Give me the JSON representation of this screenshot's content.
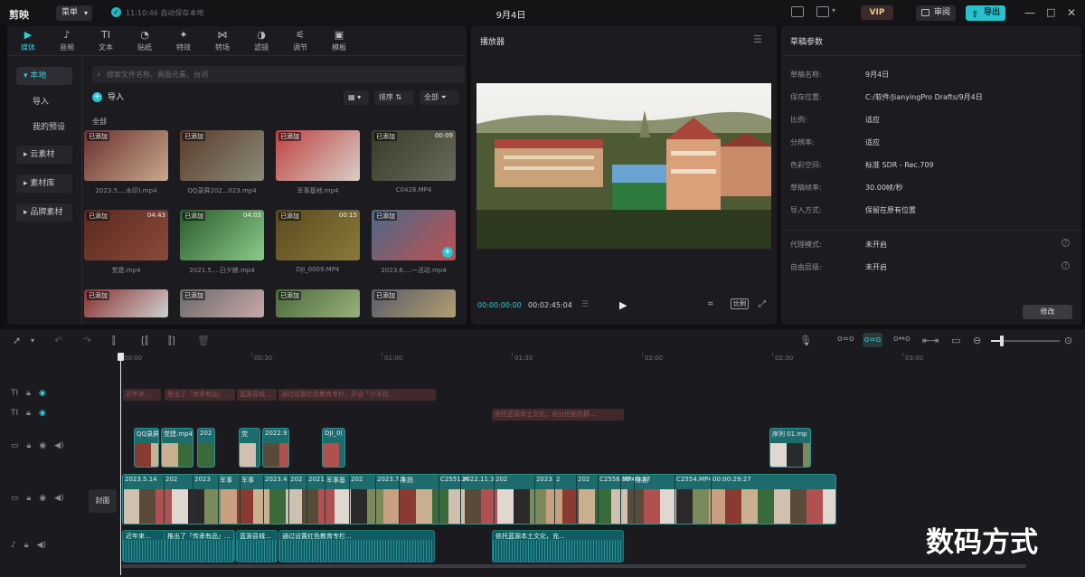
{
  "app": {
    "name": "剪映",
    "menu_label": "菜单",
    "autosave": "11:10:46 自动保存本地",
    "project_title": "9月4日",
    "vip_label": "VIP",
    "review_label": "审阅",
    "export_label": "导出"
  },
  "media_toolbar": [
    {
      "label": "媒体",
      "icon": "media-icon",
      "active": true
    },
    {
      "label": "音频",
      "icon": "audio-icon"
    },
    {
      "label": "文本",
      "icon": "text-icon"
    },
    {
      "label": "贴纸",
      "icon": "sticker-icon"
    },
    {
      "label": "特效",
      "icon": "effects-icon"
    },
    {
      "label": "转场",
      "icon": "transition-icon"
    },
    {
      "label": "滤镜",
      "icon": "filter-icon"
    },
    {
      "label": "调节",
      "icon": "adjust-icon"
    },
    {
      "label": "模板",
      "icon": "template-icon"
    }
  ],
  "media_sidebar": {
    "local": "本地",
    "import": "导入",
    "presets": "我的预设",
    "cloud": "云素材",
    "library": "素材库",
    "brand": "品牌素材"
  },
  "media": {
    "search_placeholder": "搜索文件名称、画面元素、台词",
    "import_label": "导入",
    "sort_label": "排序",
    "all_filter": "全部",
    "all_label": "全部",
    "items": [
      {
        "name": "2023.5....水印).mp4",
        "badge": "已添加",
        "duration": "",
        "colors": [
          "#6a3030",
          "#c9a98c"
        ]
      },
      {
        "name": "QQ录屏202...023.mp4",
        "badge": "已添加",
        "duration": "",
        "colors": [
          "#5a3a2a",
          "#8c8c7a"
        ]
      },
      {
        "name": "军事基地.mp4",
        "badge": "已添加",
        "duration": "",
        "colors": [
          "#c04040",
          "#d8cfc6"
        ]
      },
      {
        "name": "C0428.MP4",
        "badge": "已添加",
        "duration": "00:09",
        "colors": [
          "#3a3a2a",
          "#6a6a5a"
        ]
      },
      {
        "name": "党建.mp4",
        "badge": "已添加",
        "duration": "04:43",
        "colors": [
          "#5a2a20",
          "#8a4a3a"
        ]
      },
      {
        "name": "2021.5....日夕娘.mp4",
        "badge": "已添加",
        "duration": "04:03",
        "colors": [
          "#2a5a2a",
          "#8acc8a"
        ]
      },
      {
        "name": "DJI_0009.MP4",
        "badge": "已添加",
        "duration": "00:15",
        "colors": [
          "#5a4a20",
          "#8a7a3a"
        ]
      },
      {
        "name": "2023.6....一活动.mp4",
        "badge": "已添加",
        "duration": "",
        "colors": [
          "#4a6a8a",
          "#c05050"
        ]
      },
      {
        "name": "",
        "badge": "已添加",
        "duration": "",
        "colors": [
          "#8a3030",
          "#cfcfcf"
        ]
      },
      {
        "name": "",
        "badge": "已添加",
        "duration": "",
        "colors": [
          "#6a6a6a",
          "#c8a8a8"
        ]
      },
      {
        "name": "",
        "badge": "已添加",
        "duration": "",
        "colors": [
          "#4a6a3a",
          "#9ab07a"
        ]
      },
      {
        "name": "",
        "badge": "已添加",
        "duration": "",
        "colors": [
          "#5a5a6a",
          "#b0a070"
        ]
      }
    ]
  },
  "player": {
    "title": "播放器",
    "time_current": "00:00:00:00",
    "time_total": "00:02:45:04",
    "ratio_label": "比例"
  },
  "draft": {
    "title": "草稿参数",
    "rows": [
      {
        "key": "草稿名称:",
        "value": "9月4日"
      },
      {
        "key": "保存位置:",
        "value": "C:/软件/JianyingPro Drafts/9月4日"
      },
      {
        "key": "比例:",
        "value": "适应"
      },
      {
        "key": "分辨率:",
        "value": "适应"
      },
      {
        "key": "色彩空间:",
        "value": "标准 SDR - Rec.709"
      },
      {
        "key": "草稿帧率:",
        "value": "30.00帧/秒"
      },
      {
        "key": "导入方式:",
        "value": "保留在原有位置"
      }
    ],
    "proxy_key": "代理模式:",
    "proxy_value": "未开启",
    "layer_key": "自由层级:",
    "layer_value": "未开启",
    "modify_label": "修改"
  },
  "timeline": {
    "ruler": [
      "00:00",
      "00:30",
      "01:00",
      "01:30",
      "02:00",
      "02:30",
      "03:00"
    ],
    "cover_label": "封面",
    "text_clips_1": [
      "近年来...",
      "推出了「传承有品」...",
      "蓝源县城...",
      "通过设置红色教育专栏，开设「小手拉..."
    ],
    "text_clips_2": [
      "依托蓝源本土文化，充分挖掘农耕..."
    ],
    "overlay_clips": [
      "QQ录屏",
      "党建.mp4",
      "202",
      "党",
      "2022.9",
      "DJI_0(",
      "序列 01.mp"
    ],
    "main_clip_labels": [
      "2023.5.14",
      "202",
      "2023",
      "军事",
      "军事",
      "2023.4",
      "202",
      "2021.",
      "军事基",
      "202",
      "2023.7.1",
      "陈扬",
      "C2551.M",
      "2022.11.3",
      "202",
      "2023",
      "2",
      "202",
      "C2556.MP4",
      "00:00:17",
      "陈扬",
      "C2554.MP4",
      "00:00:29:27"
    ],
    "audio_clips": [
      "近年来...",
      "推出了「传承有品」...",
      "蓝源县城...",
      "通过设置红色教育专栏...",
      "依托蓝源本土文化，充..."
    ]
  },
  "watermark": "数码方式"
}
